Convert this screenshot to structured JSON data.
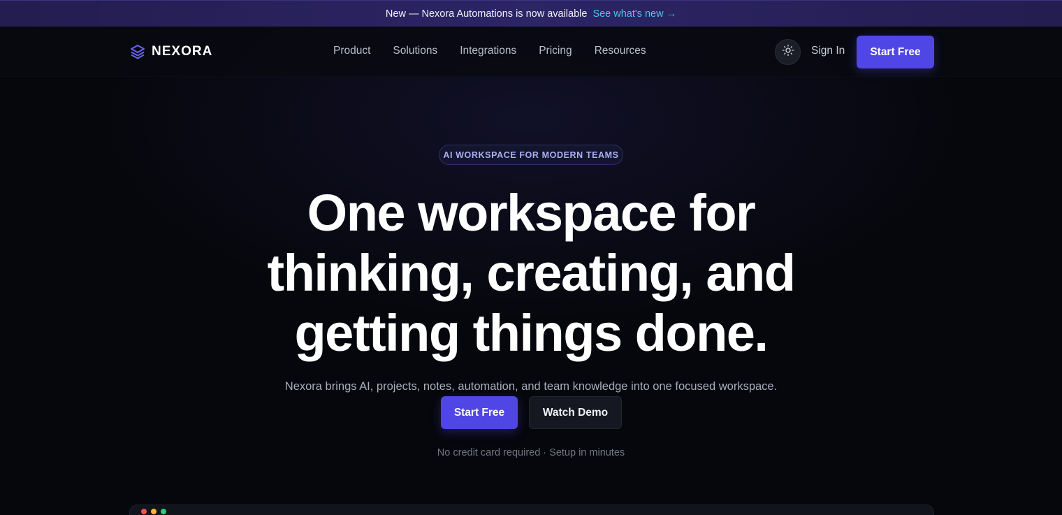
{
  "announcement": {
    "text": "New — Nexora Automations is now available",
    "link": "See what's new →"
  },
  "nav": {
    "brand": "NEXORA",
    "menu": [
      "Product",
      "Solutions",
      "Integrations",
      "Pricing",
      "Resources"
    ],
    "theme_toggle_icon": "sun-icon",
    "sign_in": "Sign In",
    "start_free": "Start Free"
  },
  "hero": {
    "badge": "AI WORKSPACE FOR MODERN TEAMS",
    "headline_lines": [
      "One workspace for",
      "thinking, creating, and",
      "getting things done."
    ],
    "subtitle": "Nexora brings AI, projects, notes, automation, and team knowledge into one focused workspace.",
    "primary_cta": "Start Free",
    "secondary_cta": "Watch Demo",
    "note": "No credit card required · Setup in minutes"
  },
  "preview": {
    "window_dots": [
      "#ef5350",
      "#f5b82e",
      "#2ecc71"
    ]
  },
  "colors": {
    "accent": "#5046e5",
    "link": "#4fc3ea",
    "background": "#06070c"
  }
}
